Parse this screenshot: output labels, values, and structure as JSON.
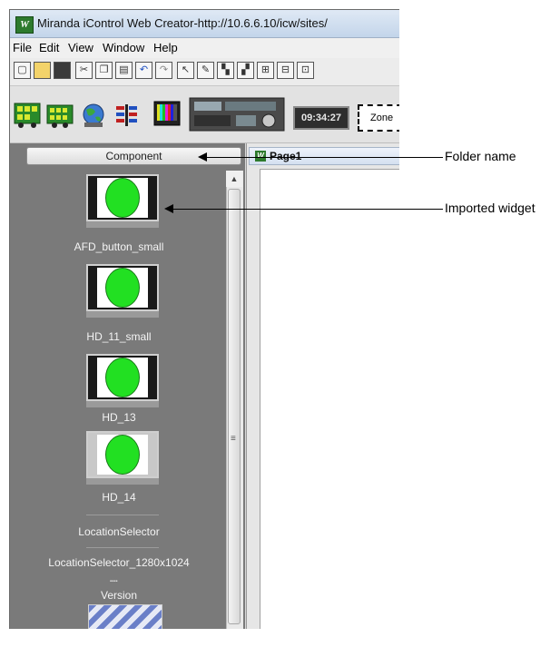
{
  "window": {
    "title": "Miranda iControl Web Creator-http://10.6.6.10/icw/sites/"
  },
  "menu": [
    "File",
    "Edit",
    "View",
    "Window",
    "Help"
  ],
  "toolbar2": {
    "clock_text": "09:34:27",
    "zone_label": "Zone"
  },
  "palette": {
    "folder_button": "Component",
    "widgets": [
      {
        "label": "AFD_button_small"
      },
      {
        "label": "HD_11_small"
      },
      {
        "label": "HD_13"
      },
      {
        "label": "HD_14"
      },
      {
        "label": "LocationSelector"
      },
      {
        "label": "LocationSelector_1280x1024"
      },
      {
        "label": "Version"
      }
    ]
  },
  "page": {
    "tab_label": "Page1"
  },
  "callouts": {
    "folder_name": "Folder name",
    "imported_widget": "Imported widget"
  }
}
